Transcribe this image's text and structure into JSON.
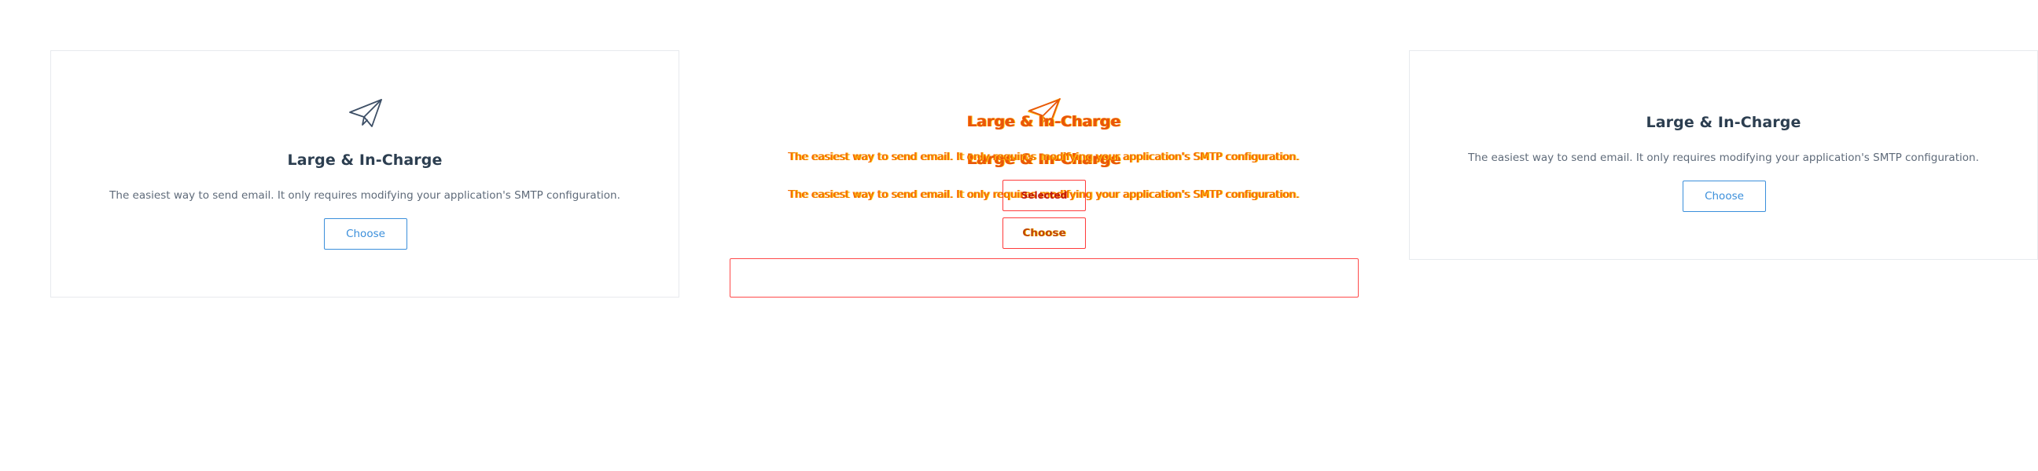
{
  "plan": {
    "title": "Large & In-Charge",
    "description": "The easiest way to send email. It only requires modifying your application's SMTP configuration.",
    "choose_label": "Choose",
    "selected_label": "Selected"
  },
  "icons": {
    "plan_icon": "paper-plane-icon"
  },
  "colors": {
    "accent": "#3b8fdb",
    "title": "#2c3e50",
    "body_text": "#5f6b7a",
    "border": "#e7eaee",
    "glitch_orange": "#f07a00",
    "glitch_red": "#ff3b3b"
  }
}
